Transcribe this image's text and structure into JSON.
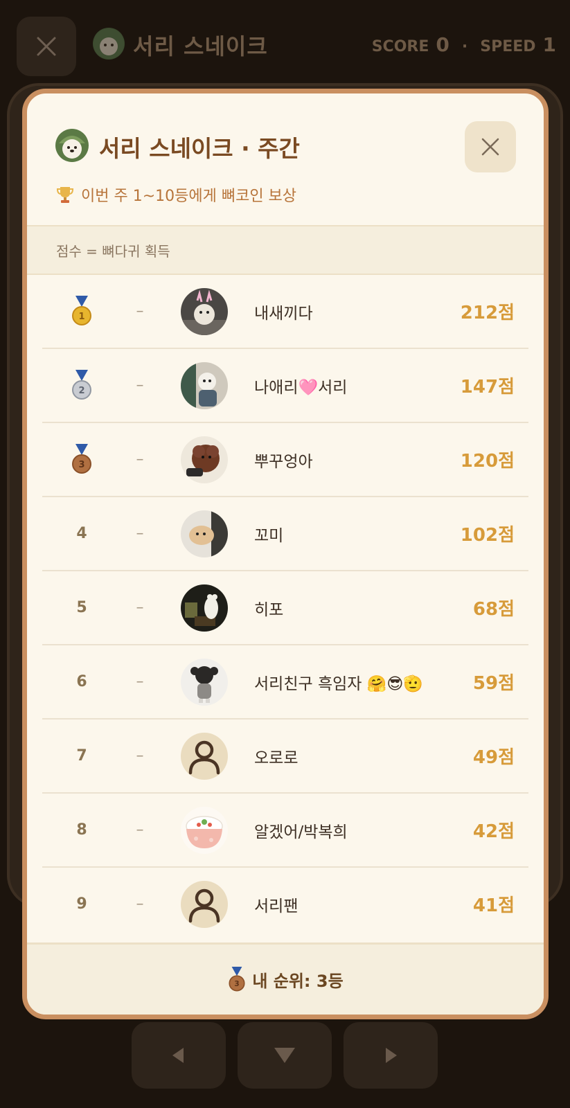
{
  "game": {
    "title": "서리 스네이크",
    "score_label": "SCORE",
    "score_value": "0",
    "separator": "·",
    "speed_label": "SPEED",
    "speed_value": "1"
  },
  "modal": {
    "title": "서리 스네이크 · 주간",
    "subtitle": "이번 주 1~10등에게 뼈코인 보상",
    "info": "점수 = 뼈다귀 획득",
    "rows": [
      {
        "rank": "1",
        "medal": "gold-medal-icon",
        "change": "–",
        "name": "내새끼다",
        "points": "212점",
        "avatar": "photo"
      },
      {
        "rank": "2",
        "medal": "silver-medal-icon",
        "change": "–",
        "name": "나애리🩷서리",
        "points": "147점",
        "avatar": "photo"
      },
      {
        "rank": "3",
        "medal": "bronze-medal-icon",
        "change": "–",
        "name": "뿌꾸엉아",
        "points": "120점",
        "avatar": "photo"
      },
      {
        "rank": "4",
        "medal": "",
        "change": "–",
        "name": "꼬미",
        "points": "102점",
        "avatar": "photo"
      },
      {
        "rank": "5",
        "medal": "",
        "change": "–",
        "name": "히포",
        "points": "68점",
        "avatar": "photo"
      },
      {
        "rank": "6",
        "medal": "",
        "change": "–",
        "name": "서리친구 흑임자 🤗😎🫡",
        "points": "59점",
        "avatar": "photo"
      },
      {
        "rank": "7",
        "medal": "",
        "change": "–",
        "name": "오로로",
        "points": "49점",
        "avatar": "default"
      },
      {
        "rank": "8",
        "medal": "",
        "change": "–",
        "name": "알겠어/박복희",
        "points": "42점",
        "avatar": "bowl"
      },
      {
        "rank": "9",
        "medal": "",
        "change": "–",
        "name": "서리팬",
        "points": "41점",
        "avatar": "default"
      }
    ],
    "my_rank": "내 순위: 3등"
  },
  "colors": {
    "accent": "#d79b3a",
    "modal_border": "#c98f60",
    "title": "#7a4a22"
  }
}
